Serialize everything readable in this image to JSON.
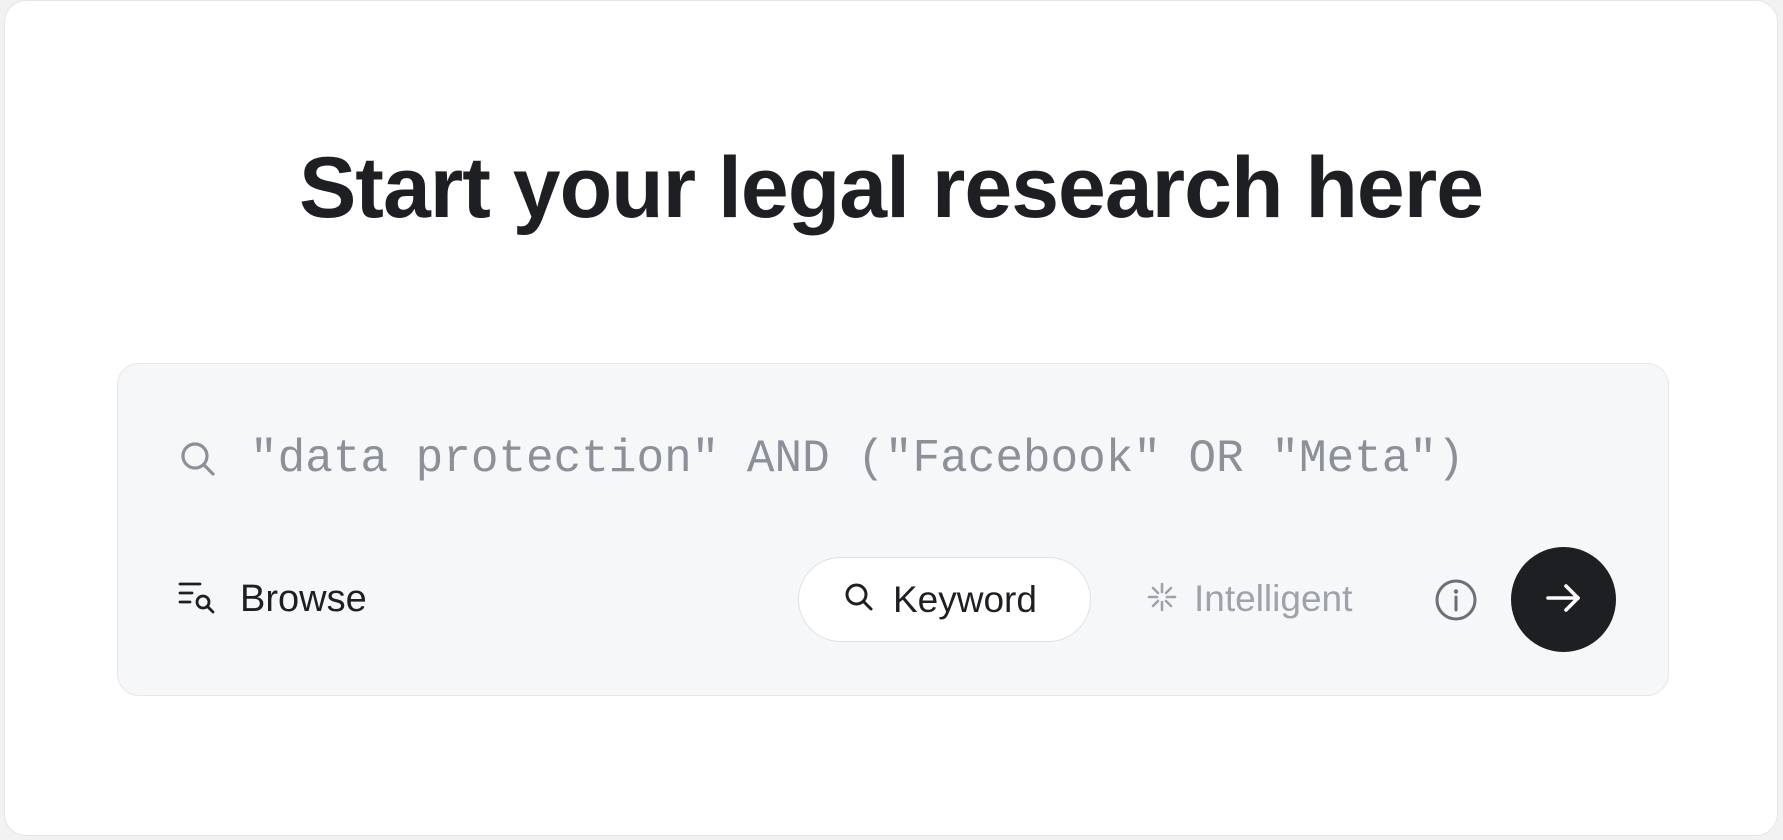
{
  "header": {
    "title": "Start your legal research here"
  },
  "search": {
    "placeholder": "\"data protection\" AND (\"Facebook\" OR \"Meta\")",
    "value": ""
  },
  "toolbar": {
    "browse_label": "Browse",
    "modes": [
      {
        "label": "Keyword",
        "icon": "search-icon",
        "selected": true
      },
      {
        "label": "Intelligent",
        "icon": "sparkle-icon",
        "selected": false
      }
    ],
    "info_icon": "info-icon",
    "submit_icon": "arrow-right-icon"
  },
  "colors": {
    "title_text": "#1d1f22",
    "card_background": "#f6f7f9",
    "placeholder_text": "#8b9099",
    "submit_button": "#1e1f22",
    "inactive_mode_text": "#9ea2a9"
  }
}
